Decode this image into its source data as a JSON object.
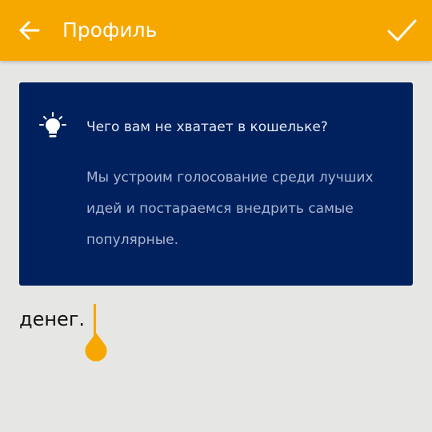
{
  "app_bar": {
    "title": "Профиль",
    "back_icon": "arrow-left-icon",
    "confirm_icon": "checkmark-icon",
    "color": "#f7a800"
  },
  "info_card": {
    "icon": "lightbulb-icon",
    "heading": "Чего вам не хватает в кошельке?",
    "body": "Мы устроим голосование среди лучших идей и постараемся внедрить самые популярные.",
    "background": "#00215e"
  },
  "text_entry": {
    "value": "денег.",
    "caret_color": "#f7a800"
  }
}
